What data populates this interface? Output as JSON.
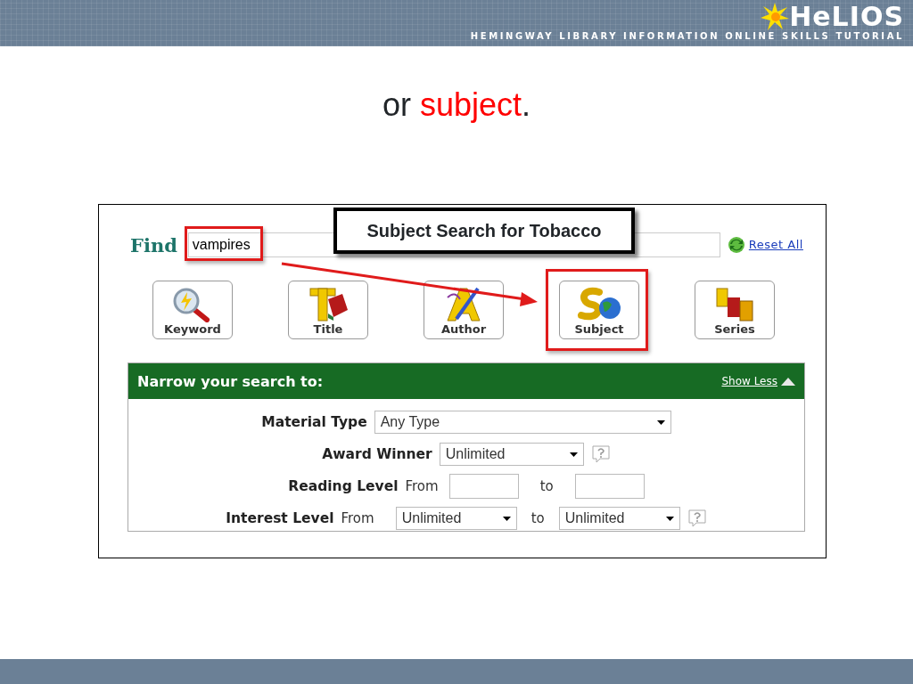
{
  "header": {
    "logo": "HeLIOS",
    "tagline": "HEMINGWAY LIBRARY INFORMATION ONLINE SKILLS TUTORIAL"
  },
  "slide_title": {
    "prefix": "or",
    "highlight": "subject",
    "suffix": "."
  },
  "screenshot": {
    "find_label": "Find",
    "search_value": "vampires",
    "reset_link": "Reset All",
    "callout": "Subject Search for Tobacco",
    "search_types": [
      {
        "label": "Keyword",
        "kind": "keyword",
        "selected": false
      },
      {
        "label": "Title",
        "kind": "title",
        "selected": false
      },
      {
        "label": "Author",
        "kind": "author",
        "selected": false
      },
      {
        "label": "Subject",
        "kind": "subject",
        "selected": true
      },
      {
        "label": "Series",
        "kind": "series",
        "selected": false
      }
    ],
    "narrow": {
      "title": "Narrow your search to:",
      "toggle": "Show Less",
      "fields": [
        {
          "kind": "select",
          "label": "Material Type",
          "value": "Any Type",
          "help": false
        },
        {
          "kind": "select",
          "label": "Award Winner",
          "value": "Unlimited",
          "help": true
        },
        {
          "kind": "range-input",
          "label": "Reading Level",
          "from": "From",
          "to": "to"
        },
        {
          "kind": "range-select",
          "label": "Interest Level",
          "from": "From",
          "from_value": "Unlimited",
          "to": "to",
          "to_value": "Unlimited",
          "help": true
        }
      ]
    }
  }
}
